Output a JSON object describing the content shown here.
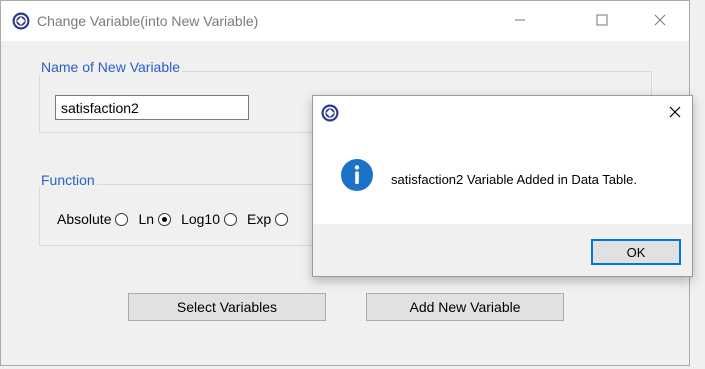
{
  "window": {
    "title": "Change Variable(into New Variable)",
    "controls": {
      "minimize_icon": "minimize-icon",
      "maximize_icon": "maximize-icon",
      "close_icon": "close-icon"
    }
  },
  "name_group": {
    "legend": "Name of New Variable",
    "value": "satisfaction2"
  },
  "function_group": {
    "legend": "Function",
    "options": [
      {
        "label": "Absolute",
        "checked": false
      },
      {
        "label": "Ln",
        "checked": true
      },
      {
        "label": "Log10",
        "checked": false
      },
      {
        "label": "Exp",
        "checked": false
      }
    ]
  },
  "buttons": {
    "select": "Select Variables",
    "add": "Add New Variable"
  },
  "dialog": {
    "message": "satisfaction2 Variable Added in Data Table.",
    "ok": "OK",
    "icon": "info-icon"
  },
  "colors": {
    "legend": "#2a5fc8",
    "info_icon": "#1a73c9",
    "focus_border": "#0078d7"
  }
}
